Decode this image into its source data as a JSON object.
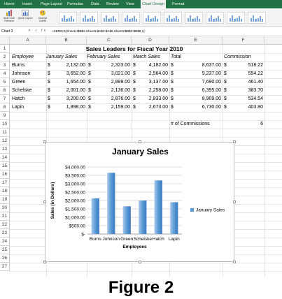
{
  "ribbon": {
    "tabs": [
      "Home",
      "Insert",
      "Page Layout",
      "Formulas",
      "Data",
      "Review",
      "View",
      "Chart Design",
      "Format"
    ],
    "active_tab": "Chart Design",
    "tools": [
      "Add Chart Element",
      "Quick Layout",
      "Change Colors"
    ]
  },
  "formula_bar": {
    "name_box": "Chart 3",
    "icons": "✕ ✓ fx",
    "formula": "=SERIES(Sheet1!$B$2,Sheet1!$A$3:$A$8,Sheet1!$B$3:$B$8,1)"
  },
  "columns": [
    "A",
    "B",
    "C",
    "D",
    "E",
    "F"
  ],
  "rows": [
    "1",
    "2",
    "3",
    "4",
    "5",
    "6",
    "7",
    "8",
    "9",
    "10",
    "11",
    "12",
    "13",
    "14",
    "15",
    "16",
    "17",
    "18",
    "19",
    "20",
    "21",
    "22",
    "23",
    "24",
    "25",
    "26",
    "27"
  ],
  "sheet": {
    "title": "Sales Leaders for Fiscal Year 2010",
    "headers": [
      "Employee",
      "January Sales",
      "February Sales",
      "March Sales",
      "Total",
      "Commission"
    ],
    "employees": [
      {
        "name": "Burns",
        "jan": "2,132.00",
        "feb": "2,323.00",
        "mar": "4,182.00",
        "total": "8,637.00",
        "comm": "518.22"
      },
      {
        "name": "Johnson",
        "jan": "3,652.00",
        "feb": "3,021.00",
        "mar": "2,564.00",
        "total": "9,237.00",
        "comm": "554.22"
      },
      {
        "name": "Green",
        "jan": "1,654.00",
        "feb": "2,899.00",
        "mar": "3,137.00",
        "total": "7,690.00",
        "comm": "461.40"
      },
      {
        "name": "Schelske",
        "jan": "2,001.00",
        "feb": "2,136.00",
        "mar": "2,258.00",
        "total": "6,395.00",
        "comm": "383.70"
      },
      {
        "name": "Hatch",
        "jan": "3,200.00",
        "feb": "2,876.00",
        "mar": "2,833.00",
        "total": "8,909.00",
        "comm": "534.54"
      },
      {
        "name": "Lapin",
        "jan": "1,898.00",
        "feb": "2,159.00",
        "mar": "2,673.00",
        "total": "6,730.00",
        "comm": "403.80"
      }
    ],
    "currency": "$",
    "commissions_label": "# of Commissions",
    "commissions_value": "6"
  },
  "chart_data": {
    "type": "bar",
    "title": "January Sales",
    "categories": [
      "Burns",
      "Johnson",
      "Green",
      "Schelske",
      "Hatch",
      "Lapin"
    ],
    "series": [
      {
        "name": "January Sales",
        "values": [
          2132,
          3652,
          1654,
          2001,
          3200,
          1898
        ]
      }
    ],
    "xlabel": "Employees",
    "ylabel": "Sales (in Dollars)",
    "ylim": [
      0,
      4000
    ],
    "yticks": [
      "$-",
      "$500.00",
      "$1,000.00",
      "$1,500.00",
      "$2,000.00",
      "$2,500.00",
      "$3,000.00",
      "$3,500.00",
      "$4,000.00"
    ],
    "grid": true,
    "legend": "right",
    "bar_color": "#5b9bd5"
  },
  "caption": "Figure 2"
}
